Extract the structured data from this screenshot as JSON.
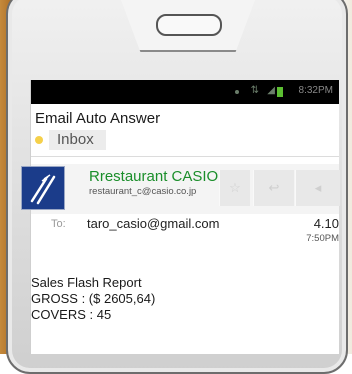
{
  "status_bar": {
    "time": "8:32PM",
    "wifi_icon": "wifi-icon",
    "signal_icon": "signal-icon",
    "battery_icon": "battery-icon"
  },
  "app": {
    "title": "Email Auto Answer",
    "label": "Inbox"
  },
  "message": {
    "sender_name": "Rrestaurant CASIO",
    "sender_email": "restaurant_c@casio.co.jp",
    "recipient_label": "To:",
    "recipient": "taro_casio@gmail.com",
    "date": "4.10",
    "time": "7:50PM",
    "body": [
      "Sales Flash Report",
      "GROSS : ($ 2605,64)",
      "COVERS : 45"
    ]
  },
  "icons": {
    "star": "star-icon",
    "reply": "reply-icon",
    "more": "chevron-down-icon",
    "avatar": "fork-knife-logo"
  },
  "colors": {
    "sender_name": "#1a8e2a",
    "avatar_bg": "#1b3c8a",
    "label_dot": "#f5d04a",
    "status_bar": "#000000"
  }
}
